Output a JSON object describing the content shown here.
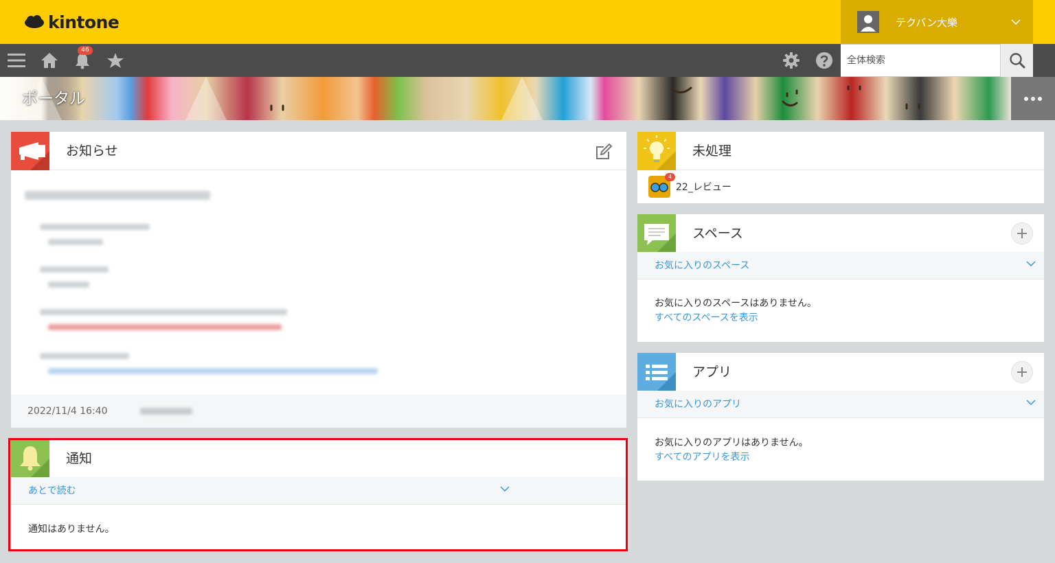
{
  "header": {
    "logo_text": "kintone",
    "user_name": "テクバン大樂"
  },
  "toolbar": {
    "notification_count": "46",
    "search_placeholder": "全体検索"
  },
  "banner": {
    "title": "ポータル"
  },
  "notice": {
    "title": "お知らせ",
    "date": "2022/11/4 16:40"
  },
  "notifications": {
    "title": "通知",
    "filter_label": "あとで読む",
    "empty_text": "通知はありません。"
  },
  "pending": {
    "title": "未処理",
    "items": [
      {
        "label": "22_レビュー",
        "badge": "4"
      }
    ]
  },
  "spaces": {
    "title": "スペース",
    "filter_label": "お気に入りのスペース",
    "empty_text": "お気に入りのスペースはありません。",
    "link_text": "すべてのスペースを表示"
  },
  "apps": {
    "title": "アプリ",
    "filter_label": "お気に入りのアプリ",
    "empty_text": "お気に入りのアプリはありません。",
    "link_text": "すべてのアプリを表示"
  },
  "colors": {
    "header_yellow": "#ffcc00",
    "user_box": "#d9ad00",
    "toolbar": "#4b4b4b",
    "link_blue": "#3498db",
    "notice_red": "#e74c3c",
    "pending_yellow": "#f0c419",
    "green": "#8cc152",
    "app_blue": "#5dade2",
    "highlight_red": "#e60012"
  }
}
